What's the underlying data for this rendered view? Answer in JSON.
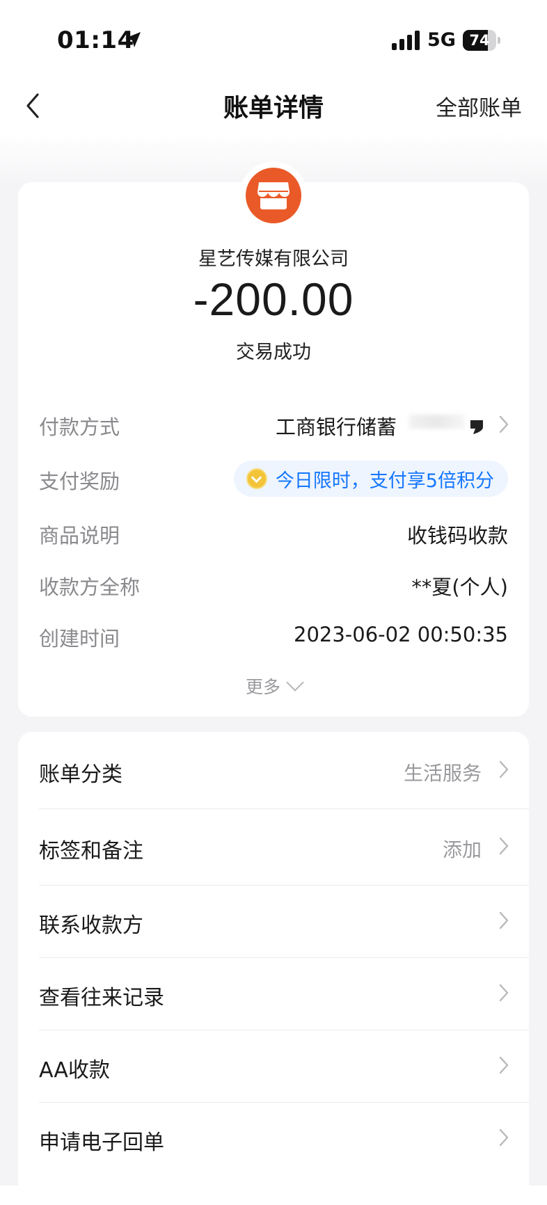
{
  "status_bar": {
    "time": "01:14",
    "network": "5G",
    "battery": "74",
    "battery_level": 0.74
  },
  "nav": {
    "title": "账单详情",
    "right_label": "全部账单"
  },
  "summary": {
    "merchant": "星艺传媒有限公司",
    "amount": "-200.00",
    "status": "交易成功"
  },
  "details": {
    "payment_method": {
      "label": "付款方式",
      "value": "工商银行储蓄"
    },
    "reward": {
      "label": "支付奖励",
      "value": "今日限时，支付享5倍积分"
    },
    "product": {
      "label": "商品说明",
      "value": "收钱码收款"
    },
    "payee": {
      "label": "收款方全称",
      "value": "**夏(个人)"
    },
    "created": {
      "label": "创建时间",
      "value": "2023-06-02 00:50:35"
    },
    "more_label": "更多"
  },
  "actions": [
    {
      "label": "账单分类",
      "value": "生活服务"
    },
    {
      "label": "标签和备注",
      "value": "添加"
    },
    {
      "label": "联系收款方",
      "value": ""
    },
    {
      "label": "查看往来记录",
      "value": ""
    },
    {
      "label": "AA收款",
      "value": ""
    },
    {
      "label": "申请电子回单",
      "value": ""
    }
  ],
  "colors": {
    "brand_orange": "#ea5a28",
    "link_blue": "#1677ff",
    "label_gray": "#8a8a8e"
  }
}
